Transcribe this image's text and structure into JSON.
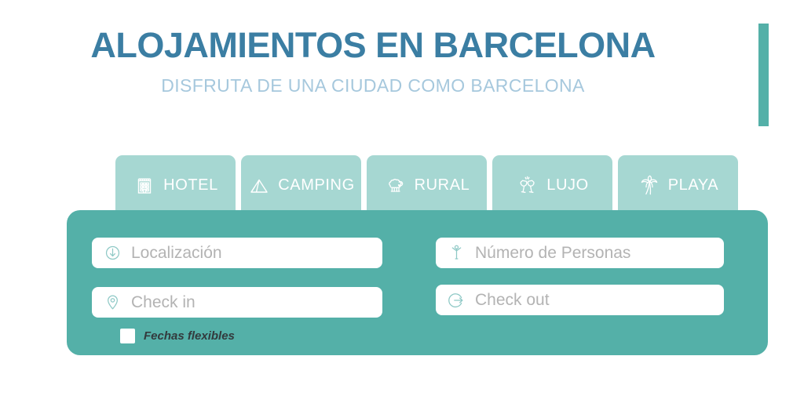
{
  "header": {
    "title": "ALOJAMIENTOS EN BARCELONA",
    "subtitle": "DISFRUTA DE  UNA CIUDAD COMO BARCELONA"
  },
  "colors": {
    "title": "#3b7ea3",
    "subtitle": "#a6c8dd",
    "panel": "#54b0a8",
    "tab": "#a6d7d2",
    "accent_bar": "#54b0a8",
    "field_background": "#ffffff",
    "placeholder": "#b3b3b3",
    "tab_label": "#ffffff"
  },
  "tabs": [
    {
      "label": "HOTEL",
      "icon": "building-icon"
    },
    {
      "label": "CAMPING",
      "icon": "tent-icon"
    },
    {
      "label": "RURAL",
      "icon": "sheep-icon"
    },
    {
      "label": "LUJO",
      "icon": "champagne-glasses-icon"
    },
    {
      "label": "PLAYA",
      "icon": "palm-tree-icon"
    }
  ],
  "search": {
    "localizacion": {
      "placeholder": "Localización",
      "value": "",
      "icon": "arrow-down-circle-icon"
    },
    "checkin": {
      "placeholder": "Check in",
      "value": "",
      "icon": "map-pin-icon"
    },
    "personas": {
      "placeholder": "Número de Personas",
      "value": "",
      "icon": "person-icon"
    },
    "checkout": {
      "placeholder": "Check out",
      "value": "",
      "icon": "arrow-out-circle-icon"
    },
    "flexible_dates": {
      "label": "Fechas flexibles",
      "checked": false
    }
  }
}
